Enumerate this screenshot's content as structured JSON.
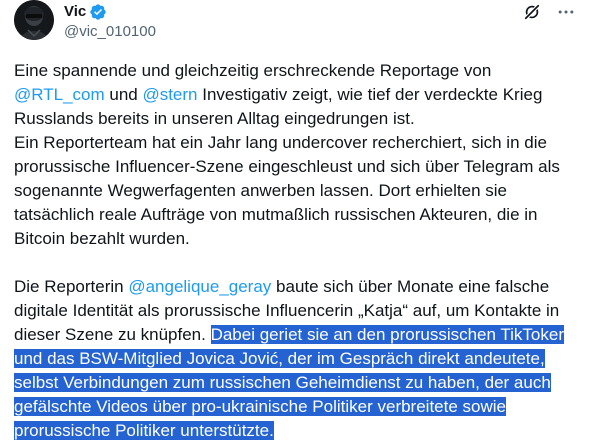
{
  "author": {
    "display_name": "Vic",
    "handle": "@vic_010100"
  },
  "icons": {
    "verified": "verified-badge-icon",
    "grok": "grok-icon",
    "more": "more-options-icon"
  },
  "colors": {
    "link": "#1d9bf0",
    "selection": "#2463d1",
    "text": "#0f1419",
    "secondary": "#536471"
  },
  "text": {
    "p1_a": "Eine spannende und gleichzeitig erschreckende Reportage von ",
    "m1": "@RTL_com",
    "p1_b": " und ",
    "m2": "@stern",
    "p1_c": " Investigativ zeigt, wie tief der verdeckte Krieg Russlands bereits in unseren Alltag eingedrungen ist.",
    "p2": "Ein Reporterteam hat ein Jahr lang undercover recherchiert, sich in die prorussische Influencer-Szene eingeschleust und sich über Telegram als sogenannte Wegwerfagenten anwerben lassen. Dort erhielten sie tatsächlich reale Aufträge von mutmaßlich russischen Akteuren, die in Bitcoin bezahlt wurden.",
    "p3_a": "Die Reporterin ",
    "m3": "@angelique_geray",
    "p3_b": " baute sich über Monate eine falsche digitale Identität als prorussische Influencerin „Katja“ auf, um Kontakte in dieser Szene zu knüpfen. ",
    "p3_selected": "Dabei geriet sie an den prorussischen TikToker und das BSW-Mitglied Jovica Jović, der im Gespräch direkt andeutete, selbst Verbindungen zum russischen Geheimdienst zu haben, der auch gefälschte Videos über pro-ukrainische Politiker verbreitete sowie prorussische Politiker unterstützte."
  }
}
